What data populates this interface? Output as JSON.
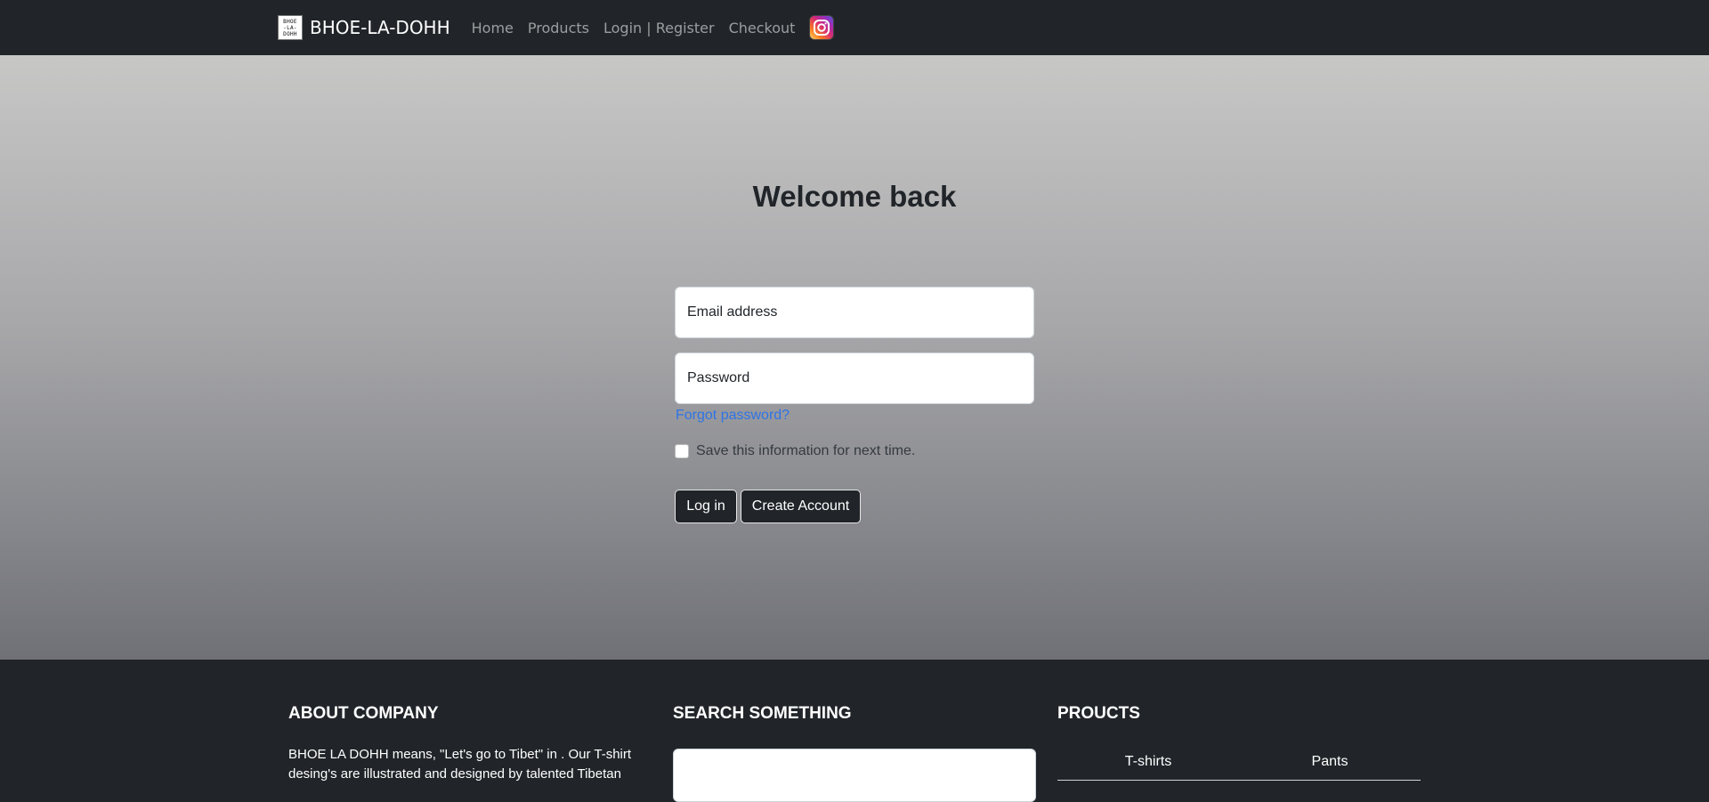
{
  "navbar": {
    "brand_name": "BHOE-LA-DOHH",
    "brand_logo_lines": [
      "BHOE",
      "-LA-",
      "DOHH"
    ],
    "links": [
      {
        "label": "Home"
      },
      {
        "label": "Products"
      },
      {
        "label": "Login | Register"
      },
      {
        "label": "Checkout"
      }
    ],
    "instagram_icon": "instagram-icon"
  },
  "login": {
    "title": "Welcome back",
    "email_placeholder": "Email address",
    "password_placeholder": "Password",
    "forgot_password": "Forgot password?",
    "remember_label": "Save this information for next time.",
    "remember_checked": false,
    "login_button": "Log in",
    "create_account_button": "Create Account"
  },
  "footer": {
    "about_title": "ABOUT COMPANY",
    "about_text": "BHOE LA DOHH means, \"Let's go to Tibet\" in . Our T-shirt desing's are illustrated and designed by talented Tibetan",
    "search_title": "SEARCH SOMETHING",
    "products_title": "PROUCTS",
    "product_tabs": [
      "T-shirts",
      "Pants"
    ]
  },
  "colors": {
    "navbar_bg": "#212529",
    "hero_gradient_top": "#c7c7c6",
    "hero_gradient_bottom": "#707177",
    "link_blue": "#2e74e6",
    "button_bg": "#212529"
  }
}
